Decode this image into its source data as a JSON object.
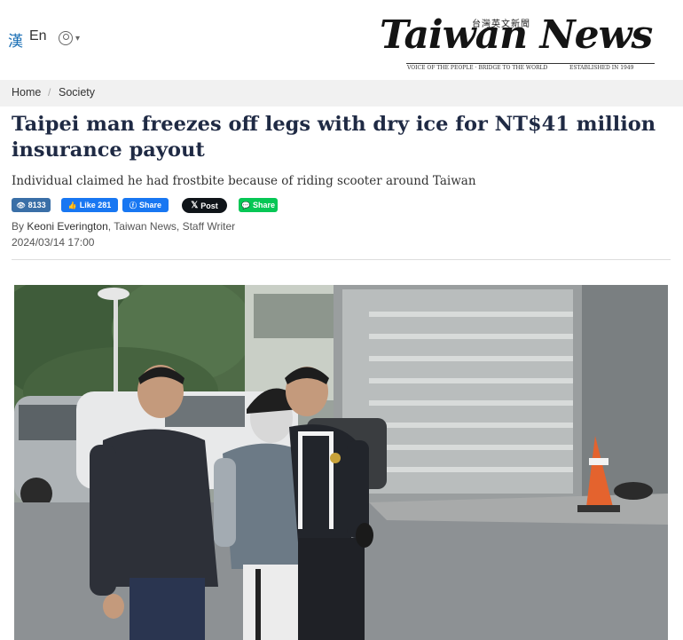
{
  "header": {
    "lang_chinese": "漢",
    "lang_english": "En",
    "user_icon": "user-icon",
    "logo": {
      "wordmark": "Taiwan News",
      "chinese_name": "台灣英文新聞",
      "tagline_left": "VOICE OF THE PEOPLE · BRIDGE TO THE WORLD",
      "tagline_right": "ESTABLISHED IN 1949"
    }
  },
  "breadcrumb": {
    "home": "Home",
    "separator": "/",
    "section": "Society"
  },
  "article": {
    "headline": "Taipei man freezes off legs with dry ice for NT$41 million insurance payout",
    "subheadline": "Individual claimed he had frostbite because of riding scooter around Taiwan",
    "views": "8133",
    "fb_like": "Like 281",
    "fb_share": "Share",
    "x_post": "Post",
    "line_share": "Share",
    "byline_prefix": "By ",
    "author": "Keoni Everington",
    "byline_suffix": ", Taiwan News, Staff Writer",
    "date": "2024/03/14 17:00"
  },
  "colors": {
    "headline": "#1f2a44",
    "facebook": "#1877f2",
    "x": "#0f1419",
    "line": "#06c755",
    "views": "#3a6fa7",
    "lang_link": "#1a6fb5"
  }
}
